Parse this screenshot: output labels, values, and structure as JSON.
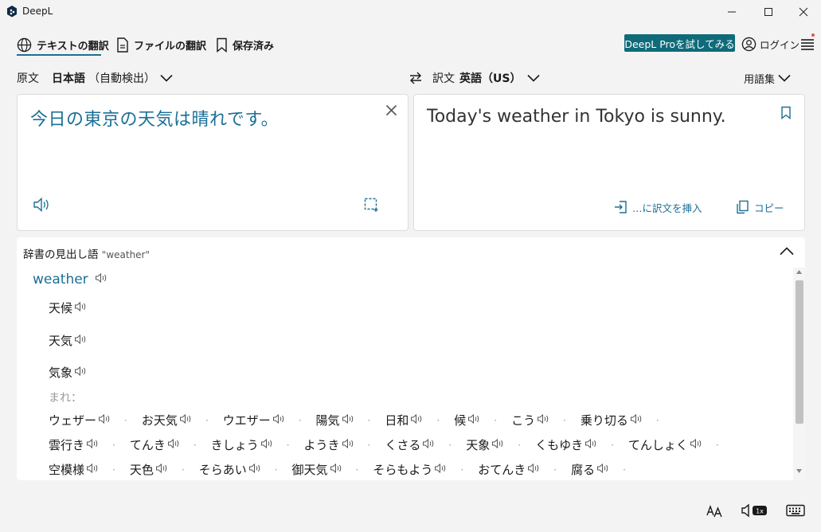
{
  "window": {
    "title": "DeepL"
  },
  "nav": {
    "tabs": [
      {
        "label": "テキストの翻訳",
        "icon": "globe-icon",
        "active": true
      },
      {
        "label": "ファイルの翻訳",
        "icon": "document-icon"
      },
      {
        "label": "保存済み",
        "icon": "bookmark-icon"
      }
    ],
    "pro_button": "DeepL Proを試してみる",
    "login": "ログイン"
  },
  "source": {
    "prefix": "原文",
    "language": "日本語",
    "detect": "（自動検出）",
    "text": "今日の東京の天気は晴れです。"
  },
  "target": {
    "prefix": "訳文",
    "language": "英語（US）",
    "glossary": "用語集",
    "text": "Today's weather in Tokyo is sunny.",
    "insert_label": "…に訳文を挿入",
    "copy_label": "コピー"
  },
  "dictionary": {
    "title": "辞書の見出し語",
    "query": "\"weather\"",
    "headword": "weather",
    "senses": [
      "天候",
      "天気",
      "気象"
    ],
    "rare_label": "まれ：",
    "synonyms": [
      [
        "ウェザー",
        "お天気",
        "ウエザー",
        "陽気",
        "日和",
        "候",
        "こう",
        "乗り切る"
      ],
      [
        "雲行き",
        "てんき",
        "きしょう",
        "ようき",
        "くさる",
        "天象",
        "くもゆき",
        "てんしょく"
      ],
      [
        "空模様",
        "天色",
        "そらあい",
        "御天気",
        "そらもよう",
        "おてんき",
        "腐る"
      ]
    ]
  },
  "colors": {
    "accent": "#1b6f96",
    "pro": "#0f6b7a"
  }
}
